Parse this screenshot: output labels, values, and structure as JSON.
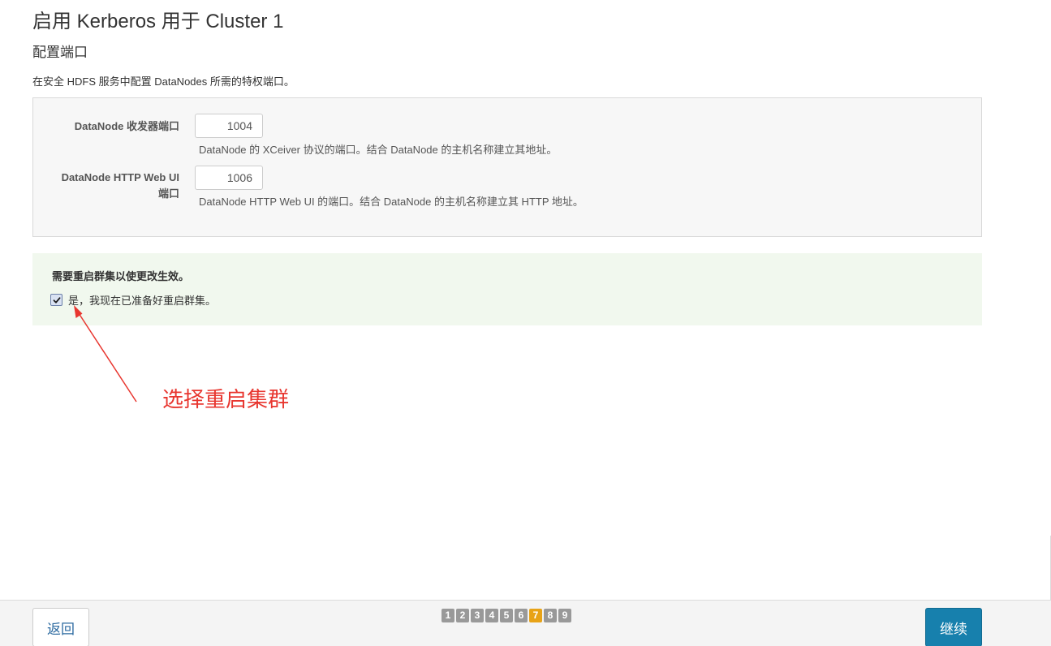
{
  "page": {
    "title": "启用 Kerberos 用于 Cluster 1",
    "subtitle": "配置端口",
    "description": "在安全 HDFS 服务中配置 DataNodes 所需的特权端口。"
  },
  "fields": [
    {
      "label": "DataNode 收发器端口",
      "value": "1004",
      "help": "DataNode 的 XCeiver 协议的端口。结合 DataNode 的主机名称建立其地址。"
    },
    {
      "label_line1": "DataNode HTTP Web UI",
      "label_line2": "端口",
      "value": "1006",
      "help": "DataNode HTTP Web UI 的端口。结合 DataNode 的主机名称建立其 HTTP 地址。"
    }
  ],
  "notice": {
    "title": "需要重启群集以使更改生效。",
    "checkbox_label": "是，我现在已准备好重启群集。",
    "checked": true
  },
  "annotation": {
    "text": "选择重启集群",
    "color": "#e8362f"
  },
  "footer": {
    "back_label": "返回",
    "continue_label": "继续",
    "steps": [
      "1",
      "2",
      "3",
      "4",
      "5",
      "6",
      "7",
      "8",
      "9"
    ],
    "current_step": "7"
  },
  "colors": {
    "primary": "#1780ad",
    "step_active": "#e8a317",
    "step_inactive": "#999999",
    "notice_bg": "#f1f8ee"
  }
}
